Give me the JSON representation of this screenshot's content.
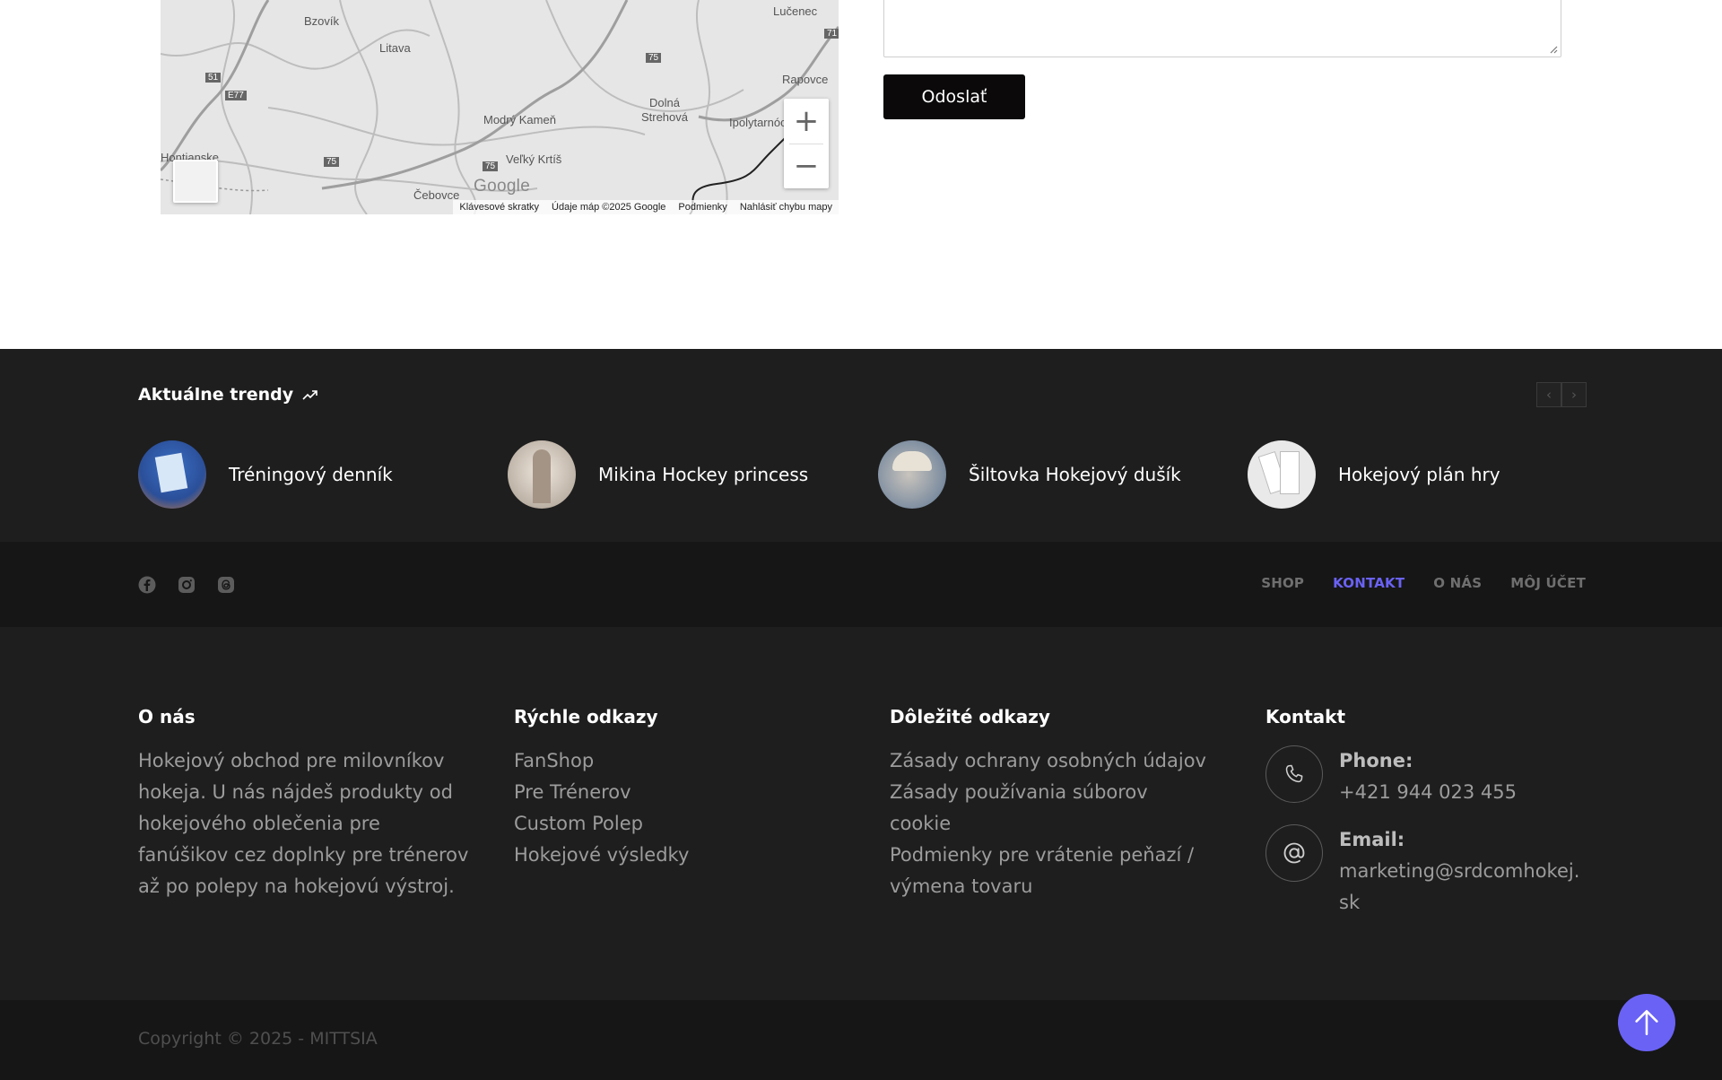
{
  "map": {
    "labels": [
      "Bzovík",
      "Litava",
      "Lučenec",
      "Rapovce",
      "Dolná Strehová",
      "Modrý Kameň",
      "Ipolytarnóc",
      "Veľký Krtíš",
      "Čebovce",
      "Hontianske",
      "51",
      "E77",
      "75",
      "75",
      "75",
      "71"
    ],
    "google_logo": "Google",
    "footer": {
      "shortcuts": "Klávesové skratky",
      "data": "Údaje máp ©2025 Google",
      "terms": "Podmienky",
      "report": "Nahlásiť chybu mapy"
    },
    "zoom_in": "+",
    "zoom_out": "−"
  },
  "form": {
    "send_label": "Odoslať"
  },
  "trends": {
    "title": "Aktuálne trendy",
    "prev": "‹",
    "next": "›",
    "items": [
      {
        "name": "Tréningový denník",
        "thumb": "training-diary-thumb"
      },
      {
        "name": "Mikina Hockey princess",
        "thumb": "hoodie-thumb"
      },
      {
        "name": "Šiltovka Hokejový dušík",
        "thumb": "cap-thumb"
      },
      {
        "name": "Hokejový plán hry",
        "thumb": "game-plan-thumb"
      }
    ]
  },
  "nav": {
    "social": [
      "facebook-icon",
      "instagram-icon",
      "threads-icon"
    ],
    "items": [
      "SHOP",
      "KONTAKT",
      "O NÁS",
      "MÔJ ÚČET"
    ],
    "active": "KONTAKT"
  },
  "footer": {
    "about": {
      "title": "O nás",
      "text": "Hokejový obchod pre milovníkov hokeja. U nás nájdeš produkty od hokejového oblečenia pre fanúšikov cez doplnky pre trénerov až po polepy na hokejovú výstroj."
    },
    "quick": {
      "title": "Rýchle odkazy",
      "links": [
        "FanShop",
        "Pre Trénerov",
        "Custom Polep",
        "Hokejové výsledky"
      ]
    },
    "important": {
      "title": "Dôležité odkazy",
      "links": [
        "Zásady ochrany osobných údajov",
        "Zásady používania súborov cookie",
        "Podmienky pre vrátenie peňazí / výmena tovaru"
      ]
    },
    "contact": {
      "title": "Kontakt",
      "phone_label": "Phone:",
      "phone": "+421 944 023 455",
      "email_label": "Email:",
      "email": "marketing@srdcomhokej.sk"
    }
  },
  "copyright": "Copyright © 2025 - MITTSIA",
  "colors": {
    "accent": "#6a62f5",
    "dark": "#1e1e1e",
    "darker": "#161616"
  }
}
